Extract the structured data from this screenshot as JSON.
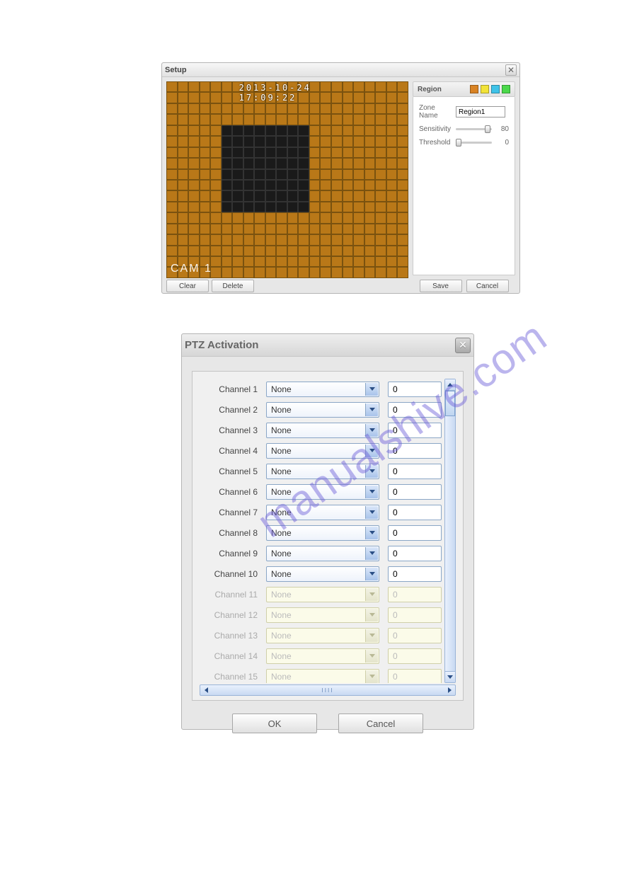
{
  "watermark": "manualshive.com",
  "setup": {
    "title": "Setup",
    "grid": {
      "cols": 22,
      "rows": 18,
      "sel_start": [
        4,
        5
      ],
      "sel_end": [
        11,
        12
      ]
    },
    "overlay_timestamp": "2013-10-24 17:09:22",
    "overlay_cam": "CAM 1",
    "buttons": {
      "clear": "Clear",
      "delete": "Delete"
    },
    "region": {
      "label": "Region",
      "swatches": [
        "#d98324",
        "#f2e338",
        "#3fc3e8",
        "#4bd94b"
      ],
      "zone_name_label": "Zone Name",
      "zone_name_value": "Region1",
      "sensitivity_label": "Sensitivity",
      "sensitivity_value": 80,
      "threshold_label": "Threshold",
      "threshold_value": 0,
      "save": "Save",
      "cancel": "Cancel"
    }
  },
  "ptz": {
    "title": "PTZ Activation",
    "channels": [
      {
        "label": "Channel 1",
        "option": "None",
        "preset": "0",
        "disabled": false
      },
      {
        "label": "Channel 2",
        "option": "None",
        "preset": "0",
        "disabled": false
      },
      {
        "label": "Channel 3",
        "option": "None",
        "preset": "0",
        "disabled": false
      },
      {
        "label": "Channel 4",
        "option": "None",
        "preset": "0",
        "disabled": false
      },
      {
        "label": "Channel 5",
        "option": "None",
        "preset": "0",
        "disabled": false
      },
      {
        "label": "Channel 6",
        "option": "None",
        "preset": "0",
        "disabled": false
      },
      {
        "label": "Channel 7",
        "option": "None",
        "preset": "0",
        "disabled": false
      },
      {
        "label": "Channel 8",
        "option": "None",
        "preset": "0",
        "disabled": false
      },
      {
        "label": "Channel 9",
        "option": "None",
        "preset": "0",
        "disabled": false
      },
      {
        "label": "Channel 10",
        "option": "None",
        "preset": "0",
        "disabled": false
      },
      {
        "label": "Channel 11",
        "option": "None",
        "preset": "0",
        "disabled": true
      },
      {
        "label": "Channel 12",
        "option": "None",
        "preset": "0",
        "disabled": true
      },
      {
        "label": "Channel 13",
        "option": "None",
        "preset": "0",
        "disabled": true
      },
      {
        "label": "Channel 14",
        "option": "None",
        "preset": "0",
        "disabled": true
      },
      {
        "label": "Channel 15",
        "option": "None",
        "preset": "0",
        "disabled": true
      }
    ],
    "buttons": {
      "ok": "OK",
      "cancel": "Cancel"
    },
    "hscroll_label": "IIII"
  }
}
